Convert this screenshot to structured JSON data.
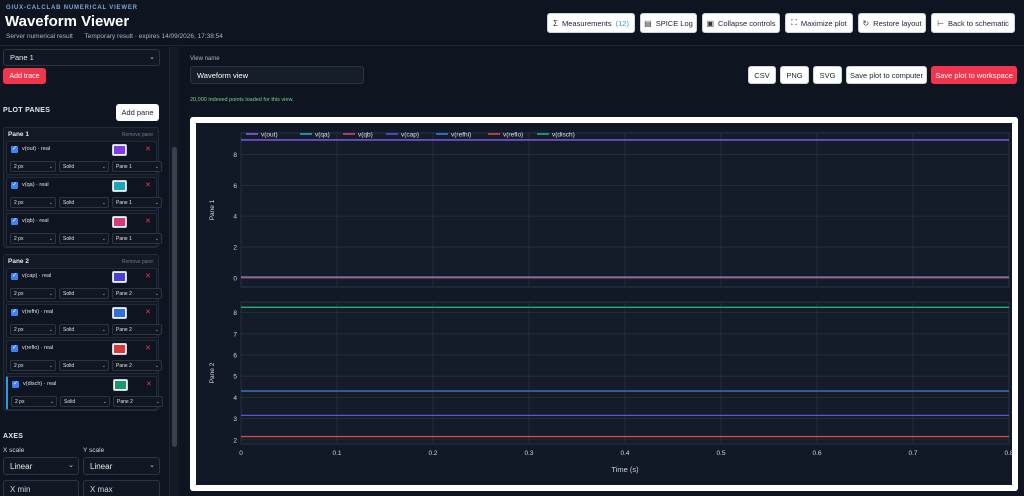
{
  "header": {
    "kicker": "GIUX-CALCLAB NUMERICAL VIEWER",
    "title": "Waveform Viewer",
    "sub1": "Server numerical result",
    "sub2": "Temporary result · expires 14/09/2026, 17:38:54",
    "buttons": {
      "measurements": "Measurements",
      "measurements_count": "(12)",
      "spice_log": "SPICE Log",
      "collapse": "Collapse controls",
      "maximize": "Maximize plot",
      "restore": "Restore layout",
      "back": "Back to schematic"
    }
  },
  "sidebar": {
    "pane_select": "Pane 1",
    "add_trace": "Add trace",
    "plot_panes_title": "PLOT PANES",
    "add_pane": "Add pane",
    "remove_pane": "Remove pane",
    "panes": [
      {
        "name": "Pane 1",
        "traces": [
          {
            "label": "v(out) · real",
            "color": "#7b3fe4",
            "width": "2 px",
            "style": "Solid",
            "pane": "Pane 1"
          },
          {
            "label": "v(qa) · real",
            "color": "#1aa5b8",
            "width": "2 px",
            "style": "Solid",
            "pane": "Pane 1"
          },
          {
            "label": "v(qb) · real",
            "color": "#d63a7a",
            "width": "2 px",
            "style": "Solid",
            "pane": "Pane 1"
          }
        ]
      },
      {
        "name": "Pane 2",
        "traces": [
          {
            "label": "v(cap) · real",
            "color": "#4a3fd8",
            "width": "2 px",
            "style": "Solid",
            "pane": "Pane 2"
          },
          {
            "label": "v(refhi) · real",
            "color": "#2f6fe0",
            "width": "2 px",
            "style": "Solid",
            "pane": "Pane 2"
          },
          {
            "label": "v(reflo) · real",
            "color": "#d83a3a",
            "width": "2 px",
            "style": "Solid",
            "pane": "Pane 2"
          },
          {
            "label": "v(disch) · real",
            "color": "#1a9a6a",
            "width": "2 px",
            "style": "Solid",
            "pane": "Pane 2"
          }
        ]
      }
    ],
    "axes": {
      "title": "AXES",
      "x_scale_label": "X scale",
      "y_scale_label": "Y scale",
      "x_scale": "Linear",
      "y_scale": "Linear",
      "x_min": "X min",
      "x_max": "X max"
    }
  },
  "main": {
    "view_name_label": "View name",
    "view_name": "Waveform view",
    "buttons": {
      "csv": "CSV",
      "png": "PNG",
      "svg": "SVG",
      "save_computer": "Save plot to computer",
      "save_workspace": "Save plot to workspace"
    },
    "status": "20,000 indexed points loaded for this view."
  },
  "chart_data": {
    "type": "line",
    "xlabel": "Time (s)",
    "xlim": [
      0,
      0.8
    ],
    "x_ticks": [
      0,
      0.1,
      0.2,
      0.3,
      0.4,
      0.5,
      0.6,
      0.7,
      0.8
    ],
    "legend": [
      {
        "name": "v(out)",
        "color": "#8a5cf0"
      },
      {
        "name": "v(qa)",
        "color": "#1fb3c8"
      },
      {
        "name": "v(qb)",
        "color": "#e0407f"
      },
      {
        "name": "v(cap)",
        "color": "#5a4ff0"
      },
      {
        "name": "v(refhi)",
        "color": "#3b7df0"
      },
      {
        "name": "v(reflo)",
        "color": "#e04545"
      },
      {
        "name": "v(disch)",
        "color": "#22b07a"
      }
    ],
    "panes": [
      {
        "ylabel": "Pane 1",
        "ylim": [
          -0.6,
          9.4
        ],
        "y_ticks": [
          0,
          2,
          4,
          6,
          8
        ],
        "series": [
          {
            "name": "v(out)",
            "color": "#8a5cf0",
            "value": 8.95
          },
          {
            "name": "v(qa)",
            "color": "#1fb3c8",
            "value": 0.05
          },
          {
            "name": "v(qb)",
            "color": "#e0407f",
            "value": 0.0
          }
        ]
      },
      {
        "ylabel": "Pane 2",
        "ylim": [
          1.8,
          8.5
        ],
        "y_ticks": [
          2,
          3,
          4,
          5,
          6,
          7,
          8
        ],
        "series": [
          {
            "name": "v(cap)",
            "color": "#5a4ff0",
            "value": 3.15
          },
          {
            "name": "v(refhi)",
            "color": "#3b7df0",
            "value": 4.3
          },
          {
            "name": "v(reflo)",
            "color": "#e04545",
            "value": 2.15
          },
          {
            "name": "v(disch)",
            "color": "#22b07a",
            "value": 8.25
          }
        ]
      }
    ]
  }
}
